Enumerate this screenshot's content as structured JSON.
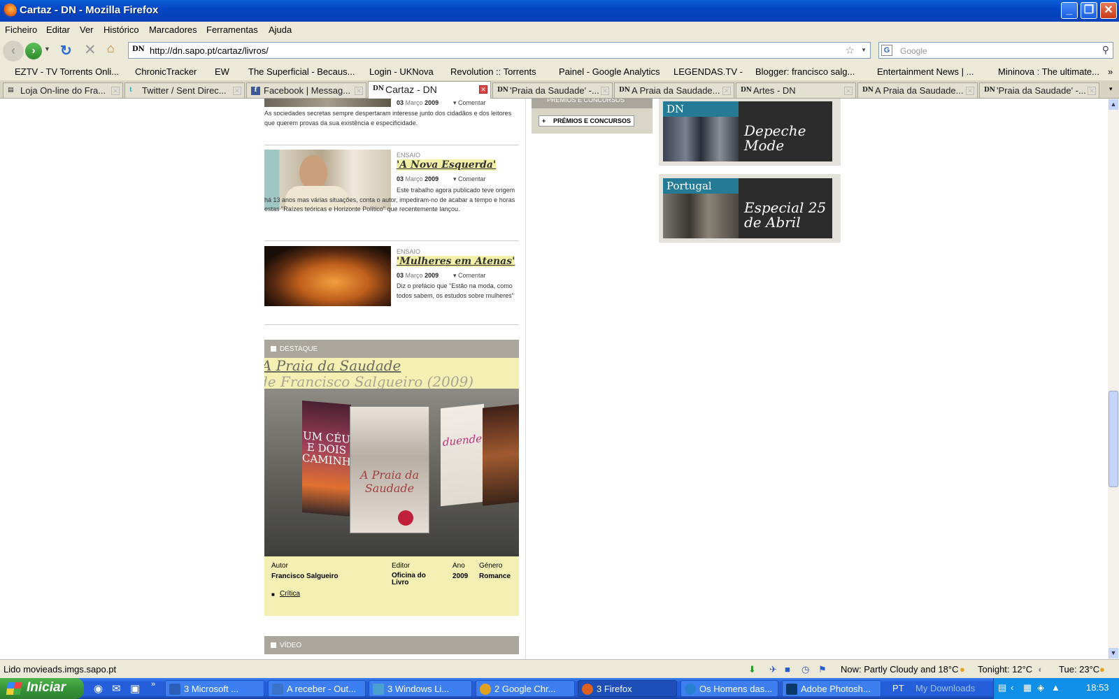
{
  "window": {
    "title": "Cartaz - DN - Mozilla Firefox"
  },
  "menu": [
    "Ficheiro",
    "Editar",
    "Ver",
    "Histórico",
    "Marcadores",
    "Ferramentas",
    "Ajuda"
  ],
  "nav": {
    "url": "http://dn.sapo.pt/cartaz/livros/",
    "search_placeholder": "Google"
  },
  "bookmarks": [
    {
      "label": "EZTV - TV Torrents Onli...",
      "color": "#3a6ea5"
    },
    {
      "label": "ChronicTracker",
      "color": "#5a9a2a"
    },
    {
      "label": "EW",
      "color": "#222"
    },
    {
      "label": "The Superficial - Becaus...",
      "color": "#8a5a2a"
    },
    {
      "label": "Login - UKNova",
      "color": "#4a3a8a"
    },
    {
      "label": "Revolution :: Torrents",
      "color": "#444"
    },
    {
      "label": "Painel - Google Analytics",
      "color": "#3a6ea5"
    },
    {
      "label": "LEGENDAS.TV -",
      "color": "#3a8ad5"
    },
    {
      "label": "Blogger: francisco salg...",
      "color": "#f07020"
    },
    {
      "label": "Entertainment News | ...",
      "color": "#c03030"
    },
    {
      "label": "Mininova : The ultimate...",
      "color": "#2a4aa5"
    }
  ],
  "tabs": [
    {
      "label": "Loja On-line do Fra...",
      "icon": "page-icon",
      "active": false
    },
    {
      "label": "Twitter / Sent Direc...",
      "icon": "twitter-icon",
      "active": false
    },
    {
      "label": "Facebook | Messag...",
      "icon": "facebook-icon",
      "active": false
    },
    {
      "label": "Cartaz - DN",
      "icon": "dn-icon",
      "active": true
    },
    {
      "label": "'Praia da Saudade' -...",
      "icon": "dn-icon",
      "active": false
    },
    {
      "label": "A Praia da Saudade...",
      "icon": "dn-icon",
      "active": false
    },
    {
      "label": "Artes - DN",
      "icon": "dn-icon",
      "active": false
    },
    {
      "label": "A Praia da Saudade...",
      "icon": "dn-icon",
      "active": false
    },
    {
      "label": "'Praia da Saudade' -...",
      "icon": "dn-icon",
      "active": false
    }
  ],
  "articles": [
    {
      "date": "03",
      "month": "Março",
      "year": "2009",
      "comment": "Comentar",
      "text": "As sociedades secretas sempre despertaram interesse junto dos cidadãos e dos leitores que querem provas da sua existência e especificidade."
    },
    {
      "category": "ENSAIO",
      "title": "'A Nova Esquerda'",
      "date": "03",
      "month": "Março",
      "year": "2009",
      "comment": "Comentar",
      "text": "Este trabalho agora publicado teve origem há 13 anos mas várias situações, conta o autor, impediram-no de acabar a tempo e horas estas \"Raízes teóricas e Horizonte Político\" que recentemente lançou."
    },
    {
      "category": "ENSAIO",
      "title": "'Mulheres em Atenas'",
      "date": "03",
      "month": "Março",
      "year": "2009",
      "comment": "Comentar",
      "text": "Diz o prefácio que \"Estão na moda, como todos sabem, os estudos sobre mulheres\""
    }
  ],
  "destaque": {
    "header": "DESTAQUE",
    "title": "A Praia da Saudade",
    "subtitle": "de Francisco Salgueiro (2009)",
    "books": [
      "UM CÉU E DOIS CAMINHOS",
      "A Praia da Saudade",
      "duende"
    ],
    "meta": {
      "autor_label": "Autor",
      "autor": "Francisco Salgueiro",
      "editor_label": "Editor",
      "editor": "Oficina do Livro",
      "ano_label": "Ano",
      "ano": "2009",
      "genero_label": "Género",
      "genero": "Romance"
    },
    "critica": "Crítica"
  },
  "video_header": "VÍDEO",
  "sidebar": {
    "premios_header": "PRÉMIOS E CONCURSOS",
    "premios_button": "PRÉMIOS E CONCURSOS",
    "promos": [
      {
        "label": "DN",
        "text": "Depeche Mode"
      },
      {
        "label": "Portugal",
        "text": "Especial 25 de Abril"
      }
    ]
  },
  "status": {
    "text": "Lido movieads.imgs.sapo.pt",
    "weather_now": "Now: Partly Cloudy and 18°C",
    "weather_tonight": "Tonight: 12°C",
    "weather_tue": "Tue: 23°C"
  },
  "taskbar": {
    "start": "Iniciar",
    "items": [
      {
        "label": "3 Microsoft ...",
        "color": "#2b5fb8"
      },
      {
        "label": "A receber - Out...",
        "color": "#3a74c8"
      },
      {
        "label": "3 Windows Li...",
        "color": "#4aa0d0"
      },
      {
        "label": "2 Google Chr...",
        "color": "#e0a020"
      },
      {
        "label": "3 Firefox",
        "color": "#e06020"
      },
      {
        "label": "Os Homens das...",
        "color": "#2a80d0"
      },
      {
        "label": "Adobe Photosh...",
        "color": "#0a3a6a"
      }
    ],
    "lang": "PT",
    "downloads": "My Downloads",
    "clock": "18:53"
  }
}
